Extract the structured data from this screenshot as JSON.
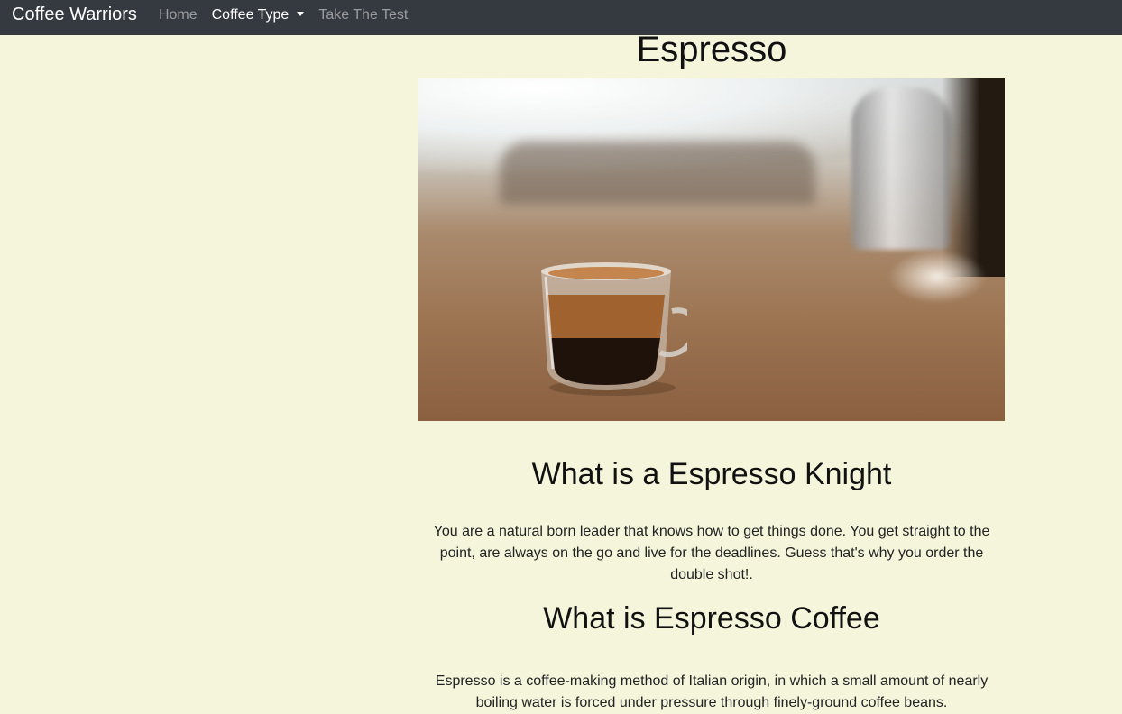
{
  "nav": {
    "brand": "Coffee Warriors",
    "links": [
      {
        "label": "Home"
      },
      {
        "label": "Coffee Type"
      },
      {
        "label": "Take The Test"
      }
    ]
  },
  "main": {
    "title": "Espresso",
    "image_alt": "Espresso cup on wooden table",
    "sections": [
      {
        "heading": "What is a Espresso Knight",
        "text": "You are a natural born leader that knows how to get things done. You get straight to the point, are always on the go and live for the deadlines. Guess that's why you order the double shot!."
      },
      {
        "heading": "What is Espresso Coffee",
        "text": "Espresso is a coffee-making method of Italian origin, in which a small amount of nearly boiling water is forced under pressure through finely-ground coffee beans."
      }
    ]
  },
  "colors": {
    "navbar": "#343a40",
    "background": "#f5f5dc",
    "nav_muted": "#9a9da0"
  }
}
